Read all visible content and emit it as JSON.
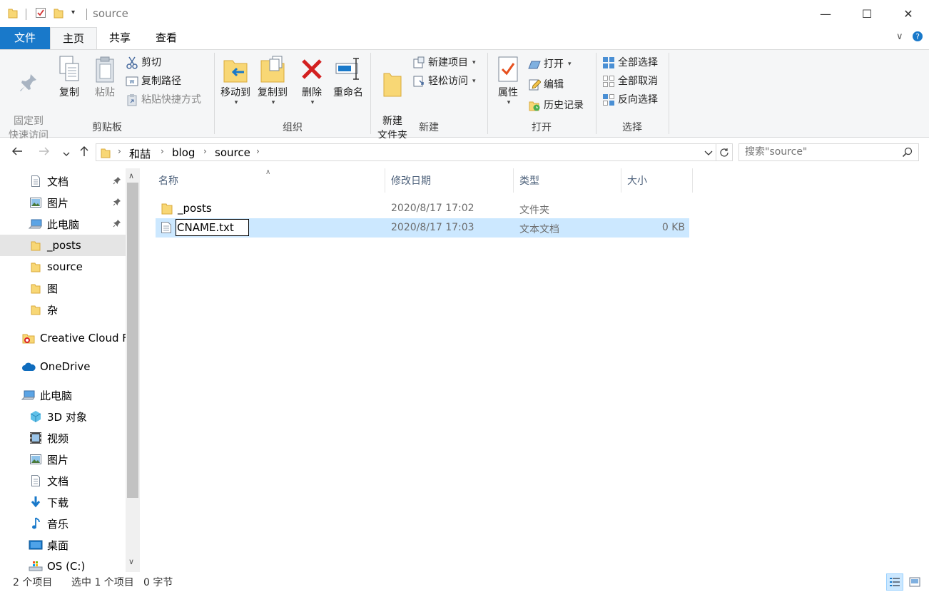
{
  "window": {
    "title": "source",
    "minimize": "—",
    "maximize": "☐",
    "close": "✕"
  },
  "tabs": {
    "file": "文件",
    "home": "主页",
    "share": "共享",
    "view": "查看"
  },
  "ribbon": {
    "clipboard": {
      "label": "剪贴板",
      "pin": "固定到\n快速访问",
      "copy": "复制",
      "paste": "粘贴",
      "cut": "剪切",
      "copy_path": "复制路径",
      "paste_shortcut": "粘贴快捷方式"
    },
    "organize": {
      "label": "组织",
      "move_to": "移动到",
      "copy_to": "复制到",
      "delete": "删除",
      "rename": "重命名"
    },
    "new": {
      "label": "新建",
      "new_folder": "新建\n文件夹",
      "new_item": "新建项目",
      "easy_access": "轻松访问"
    },
    "open": {
      "label": "打开",
      "properties": "属性",
      "open": "打开",
      "edit": "编辑",
      "history": "历史记录"
    },
    "select": {
      "label": "选择",
      "select_all": "全部选择",
      "select_none": "全部取消",
      "invert": "反向选择"
    }
  },
  "address": {
    "crumbs": [
      "和喆",
      "blog",
      "source"
    ],
    "search_placeholder": "搜索\"source\""
  },
  "nav": {
    "items": [
      {
        "label": "文档",
        "icon": "document-icon",
        "pinned": true
      },
      {
        "label": "图片",
        "icon": "pictures-icon",
        "pinned": true
      },
      {
        "label": "此电脑",
        "icon": "computer-icon",
        "pinned": true
      },
      {
        "label": "_posts",
        "icon": "folder-icon",
        "selected": true
      },
      {
        "label": "source",
        "icon": "folder-icon"
      },
      {
        "label": "图",
        "icon": "folder-icon"
      },
      {
        "label": "杂",
        "icon": "folder-icon"
      },
      {
        "label": "Creative Cloud Files",
        "icon": "creative-cloud-icon"
      },
      {
        "label": "OneDrive",
        "icon": "cloud-icon"
      },
      {
        "label": "此电脑",
        "icon": "computer-icon"
      },
      {
        "label": "3D 对象",
        "icon": "cube-icon"
      },
      {
        "label": "视频",
        "icon": "video-icon"
      },
      {
        "label": "图片",
        "icon": "pictures-icon"
      },
      {
        "label": "文档",
        "icon": "document-icon"
      },
      {
        "label": "下载",
        "icon": "download-icon"
      },
      {
        "label": "音乐",
        "icon": "music-icon"
      },
      {
        "label": "桌面",
        "icon": "desktop-icon"
      },
      {
        "label": "OS (C:)",
        "icon": "drive-icon"
      }
    ]
  },
  "columns": {
    "name": "名称",
    "modified": "修改日期",
    "type": "类型",
    "size": "大小"
  },
  "files": [
    {
      "name": "_posts",
      "modified": "2020/8/17 17:02",
      "type": "文件夹",
      "size": "",
      "icon": "folder-icon"
    },
    {
      "name": "CNAME.txt",
      "modified": "2020/8/17 17:03",
      "type": "文本文档",
      "size": "0 KB",
      "icon": "text-file-icon",
      "selected": true,
      "renaming": true
    }
  ],
  "status": {
    "count": "2 个项目",
    "selected": "选中 1 个项目",
    "bytes": "0 字节"
  },
  "colors": {
    "accent": "#1979ca",
    "selection": "#cce8ff",
    "folder": "#f8d775"
  }
}
